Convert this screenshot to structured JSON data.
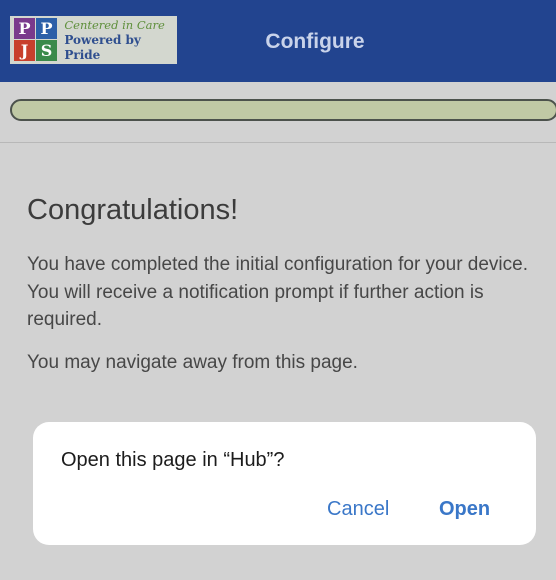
{
  "header": {
    "title": "Configure",
    "logo": {
      "line1": "Centered in Care",
      "line2": "Powered by Pride",
      "mark_letters": [
        "P",
        "P",
        "J",
        "S"
      ]
    },
    "colors": {
      "background": "#22448f",
      "title": "#c9d3ea"
    }
  },
  "progress": {
    "value_percent": 100,
    "fill_color": "#c0c9a5"
  },
  "main": {
    "heading": "Congratulations!",
    "paragraph1": "You have completed the initial configuration for your device. You will receive a notification prompt if further action is required.",
    "paragraph2": "You may navigate away from this page."
  },
  "dialog": {
    "message": "Open this page in “Hub”?",
    "cancel_label": "Cancel",
    "open_label": "Open",
    "accent_color": "#3a77c8"
  }
}
